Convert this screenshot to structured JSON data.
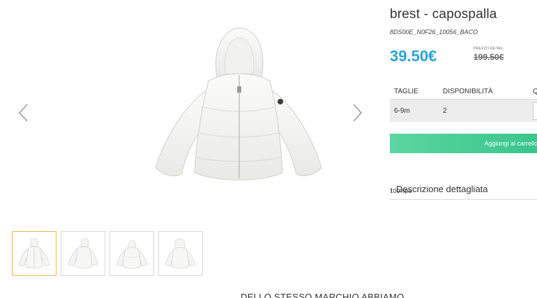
{
  "product": {
    "title": "brest - capospalla",
    "sku": "8DS00E_N0F26_10056_BACO",
    "price": "39.50€",
    "retail_label": "PREZZO RETAIL",
    "retail_price": "199.50€",
    "composition": "100%pa"
  },
  "gallery": {
    "main_image": "white-puffer-jacket-with-hood",
    "thumbnails": [
      {
        "image": "jacket-front-view",
        "active": true
      },
      {
        "image": "jacket-side-view",
        "active": false
      },
      {
        "image": "jacket-back-view",
        "active": false
      },
      {
        "image": "jacket-hood-detail-view",
        "active": false
      }
    ]
  },
  "size_table": {
    "headers": {
      "size": "TAGLIE",
      "availability": "DISPONIBILITÀ",
      "quantity": "Q"
    },
    "rows": [
      {
        "size": "6-9m",
        "availability": "2"
      }
    ]
  },
  "add_to_cart_label": "Aggiungi al carrello",
  "description_toggle": "Descrizione dettagliata",
  "same_brand_heading": "DELLO STESSO MARCHIO ABBIAMO",
  "colors": {
    "price": "#2aa3d8",
    "add_button": "#36c48a",
    "thumb_active_border": "#f0b45a"
  }
}
